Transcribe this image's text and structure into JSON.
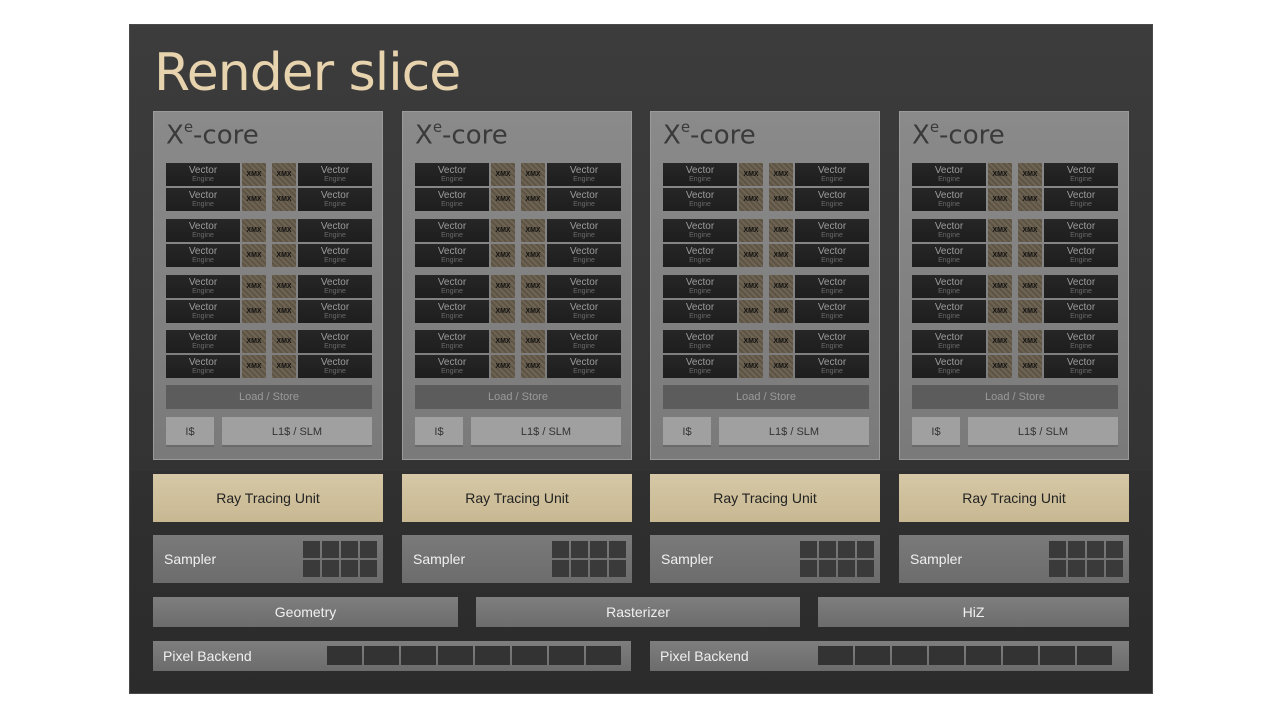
{
  "title": "Render slice",
  "core": {
    "title_x": "X",
    "title_sup": "e",
    "title_rest": "-core",
    "vector_label": "Vector",
    "vector_sub": "Engine",
    "xmx_label": "XMX",
    "load_store": "Load / Store",
    "icache": "I$",
    "l1": "L1$ / SLM"
  },
  "ray_tracing_label": "Ray Tracing Unit",
  "sampler_label": "Sampler",
  "geometry_label": "Geometry",
  "rasterizer_label": "Rasterizer",
  "hiz_label": "HiZ",
  "pixel_backend_label": "Pixel Backend",
  "core_count": 4,
  "colors": {
    "title": "#e7d3ad",
    "ray_tracing": "#d3c49f",
    "xmx": "#6f6453",
    "vector_engine": "#222222"
  }
}
